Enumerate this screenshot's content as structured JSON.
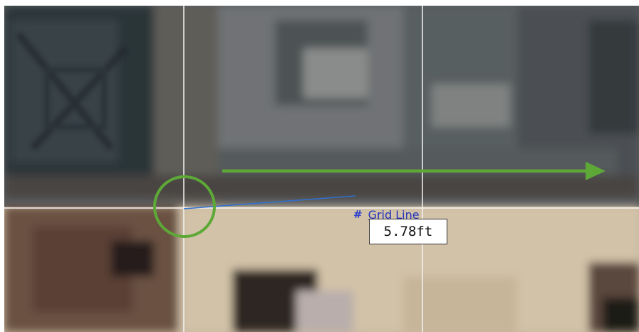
{
  "canvas": {
    "snap_label": "Grid Line",
    "measurement": "5.78ft",
    "colors": {
      "annotation_green": "#5ea838",
      "sketch_line_blue": "#2f6fcf",
      "grid_line": "#f4f4f4",
      "tag_text_blue": "#2233bb"
    },
    "icons": {
      "snap_marker": "grid-snap-icon"
    }
  }
}
